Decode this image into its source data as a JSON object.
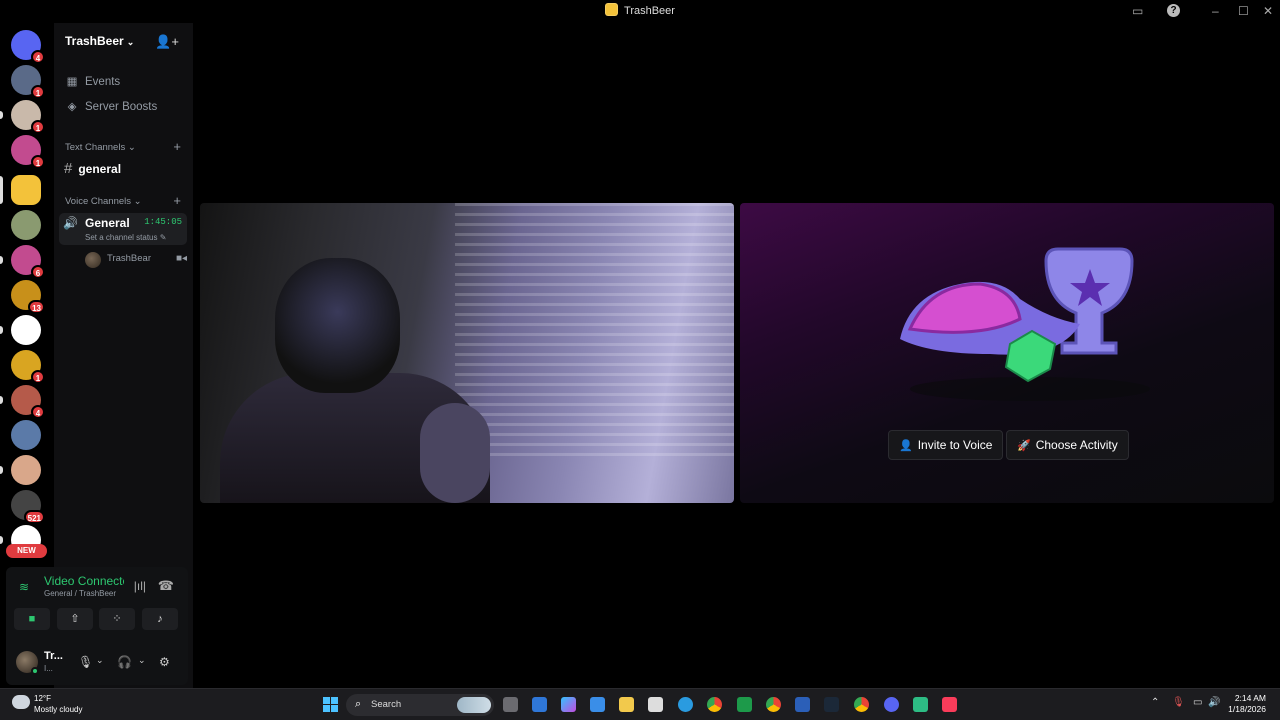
{
  "window": {
    "title": "TrashBeer"
  },
  "rail": {
    "servers": [
      {
        "id": "discord-home",
        "badge": "4",
        "color": "#5865f2"
      },
      {
        "id": "srv-1",
        "badge": "1",
        "color": "#5a6a88"
      },
      {
        "id": "srv-2",
        "badge": "1",
        "color": "#c9b9aa"
      },
      {
        "id": "srv-3",
        "badge": "1",
        "color": "#c24b8f"
      },
      {
        "id": "srv-trashbeer",
        "badge": "",
        "color": "#f3c23a"
      },
      {
        "id": "srv-5",
        "badge": "",
        "color": "#8a9a70"
      },
      {
        "id": "srv-6",
        "badge": "6",
        "color": "#c24b8f"
      },
      {
        "id": "srv-7",
        "badge": "13",
        "color": "#c8901a"
      },
      {
        "id": "srv-chatgpt",
        "badge": "",
        "color": "#ffffff"
      },
      {
        "id": "srv-9",
        "badge": "1",
        "color": "#d9a521"
      },
      {
        "id": "srv-10",
        "badge": "4",
        "color": "#b55a4a"
      },
      {
        "id": "srv-11",
        "badge": "",
        "color": "#5b7aa8"
      },
      {
        "id": "srv-12",
        "badge": "",
        "color": "#d9a78a"
      },
      {
        "id": "srv-13",
        "badge": "521",
        "color": "#444"
      },
      {
        "id": "srv-14",
        "badge": "",
        "color": "#ffffff"
      }
    ],
    "new_label": "NEW"
  },
  "sidebar": {
    "server_name": "TrashBeer",
    "events_label": "Events",
    "boosts_label": "Server Boosts",
    "text_category": "Text Channels",
    "text_channel": "general",
    "voice_category": "Voice Channels",
    "voice_channel": "General",
    "voice_timer": "1:45:05",
    "voice_status_placeholder": "Set a channel status",
    "voice_user": "TrashBear"
  },
  "rtc": {
    "status": "Video Connected",
    "location": "General / TrashBeer"
  },
  "user": {
    "name": "Tr...",
    "sub": "I..."
  },
  "activity": {
    "invite_label": "Invite to Voice",
    "activity_label": "Choose Activity"
  },
  "taskbar": {
    "temp": "12°F",
    "weather": "Mostly cloudy",
    "search_label": "Search",
    "time": "2:14 AM",
    "date": "1/18/2026"
  },
  "colors": {
    "accent_green": "#2dc770",
    "badge_red": "#e03b3f",
    "brand": "#5865f2"
  }
}
